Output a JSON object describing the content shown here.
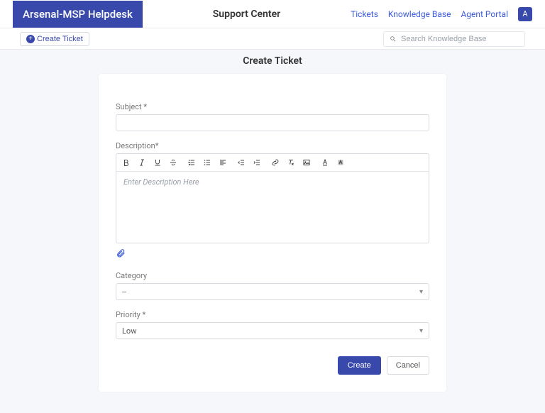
{
  "header": {
    "logo": "Arsenal-MSP Helpdesk",
    "center": "Support Center",
    "nav": {
      "tickets": "Tickets",
      "kb": "Knowledge Base",
      "agent": "Agent Portal"
    },
    "avatar_initial": "A"
  },
  "secondbar": {
    "create_label": "Create Ticket",
    "search_placeholder": "Search Knowledge Base"
  },
  "page": {
    "title": "Create Ticket"
  },
  "form": {
    "subject_label": "Subject *",
    "subject_value": "",
    "description_label": "Description*",
    "description_placeholder": "Enter Description Here",
    "category_label": "Category",
    "category_value": "--",
    "priority_label": "Priority *",
    "priority_value": "Low",
    "btn_create": "Create",
    "btn_cancel": "Cancel"
  }
}
